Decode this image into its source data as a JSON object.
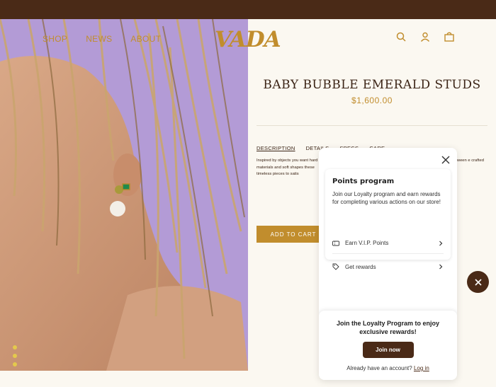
{
  "nav": {
    "items": [
      "SHOP",
      "NEWS",
      "ABOUT"
    ]
  },
  "brand": {
    "logo": "VADA"
  },
  "header_icons": [
    "search-icon",
    "account-icon",
    "bag-icon"
  ],
  "product": {
    "title": "BABY BUBBLE EMERALD STUDS",
    "price": "$1,600.00",
    "tabs": [
      "DESCRIPTION",
      "DETAILS",
      "SPECS",
      "CARE"
    ],
    "description_left": "Inspired by objects you want hard materials and soft shapes these timeless pieces to satis",
    "description_right": "e between e crafted",
    "add_to_cart": "ADD TO CART"
  },
  "loyalty": {
    "card_title": "Points program",
    "card_text": "Join our Loyalty program and earn rewards for completing various actions on our store!",
    "rows": [
      {
        "label": "Earn V.I.P. Points",
        "icon": "coupon-icon"
      },
      {
        "label": "Get rewards",
        "icon": "tag-icon"
      }
    ],
    "footer_title": "Join the Loyalty Program to enjoy exclusive rewards!",
    "join_label": "Join now",
    "account_text": "Already have an account?",
    "login_label": "Log in"
  },
  "colors": {
    "brown": "#4a2a17",
    "gold": "#c18d2d",
    "cream": "#fbf8f1",
    "lavender": "#b49ad6"
  }
}
